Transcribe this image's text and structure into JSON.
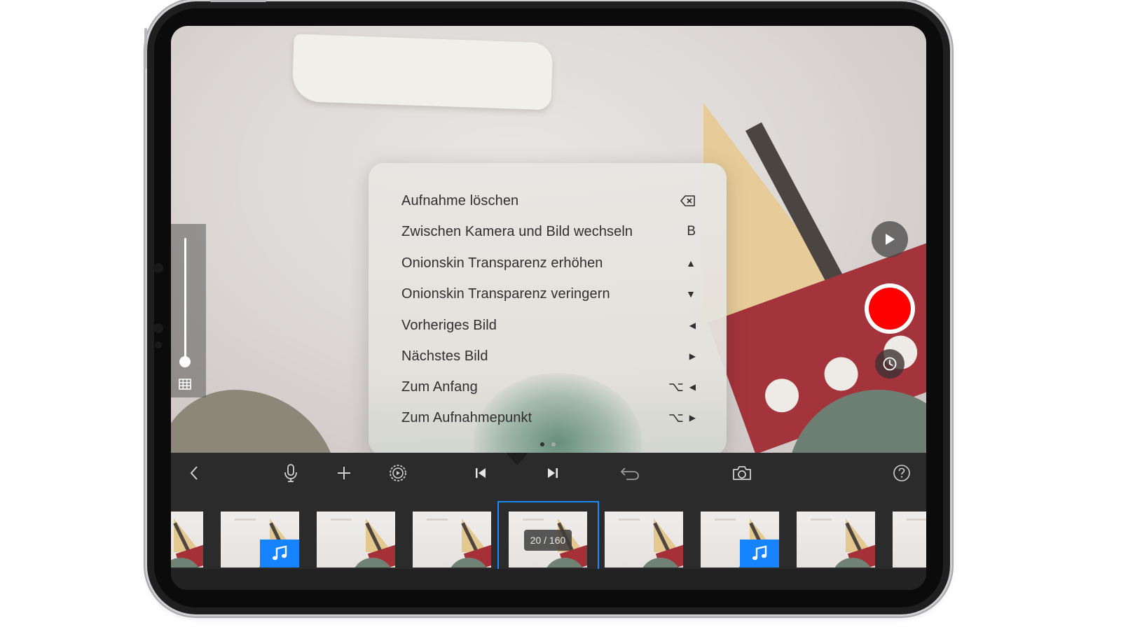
{
  "popup": {
    "shortcuts": [
      {
        "label": "Aufnahme löschen",
        "key": "⌫",
        "key_icon": "delete-backward-icon"
      },
      {
        "label": "Zwischen Kamera und Bild wechseln",
        "key": "B"
      },
      {
        "label": "Onionskin Transparenz erhöhen",
        "key": "▲"
      },
      {
        "label": "Onionskin Transparenz veringern",
        "key": "▼"
      },
      {
        "label": "Vorheriges Bild",
        "key": "◀"
      },
      {
        "label": "Nächstes Bild",
        "key": "▶"
      },
      {
        "label": "Zum Anfang",
        "modifier": "⌥",
        "key": "◀"
      },
      {
        "label": "Zum Aufnahmepunkt",
        "modifier": "⌥",
        "key": "▶"
      }
    ],
    "page_count": 2,
    "current_page": 1
  },
  "toolbar": {
    "items": [
      "back-chevron-icon",
      "microphone-icon",
      "plus-icon",
      "settings-gear-icon",
      "skip-to-start-icon",
      "skip-to-end-icon",
      "undo-icon",
      "camera-icon",
      "help-icon"
    ]
  },
  "camera": {
    "onion_skin_level": 0.0,
    "controls": [
      "play-icon",
      "record-icon",
      "timer-icon"
    ]
  },
  "filmstrip": {
    "frame_counter": "20 / 160",
    "frames_with_audio": [
      2,
      7
    ],
    "selected_frame_index": 5
  },
  "colors": {
    "record": "#ff0000",
    "selection": "#1a8bff",
    "audio_badge": "#1683ff",
    "toolbar_bg": "#2b2b2b"
  }
}
